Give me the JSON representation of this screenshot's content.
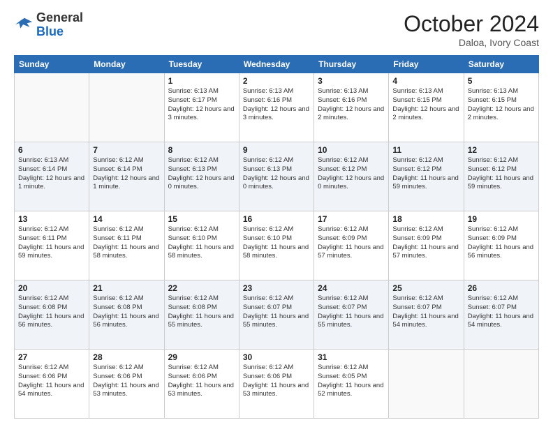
{
  "header": {
    "logo_line1": "General",
    "logo_line2": "Blue",
    "month": "October 2024",
    "location": "Daloa, Ivory Coast"
  },
  "days_of_week": [
    "Sunday",
    "Monday",
    "Tuesday",
    "Wednesday",
    "Thursday",
    "Friday",
    "Saturday"
  ],
  "weeks": [
    [
      {
        "day": "",
        "info": ""
      },
      {
        "day": "",
        "info": ""
      },
      {
        "day": "1",
        "info": "Sunrise: 6:13 AM\nSunset: 6:17 PM\nDaylight: 12 hours and 3 minutes."
      },
      {
        "day": "2",
        "info": "Sunrise: 6:13 AM\nSunset: 6:16 PM\nDaylight: 12 hours and 3 minutes."
      },
      {
        "day": "3",
        "info": "Sunrise: 6:13 AM\nSunset: 6:16 PM\nDaylight: 12 hours and 2 minutes."
      },
      {
        "day": "4",
        "info": "Sunrise: 6:13 AM\nSunset: 6:15 PM\nDaylight: 12 hours and 2 minutes."
      },
      {
        "day": "5",
        "info": "Sunrise: 6:13 AM\nSunset: 6:15 PM\nDaylight: 12 hours and 2 minutes."
      }
    ],
    [
      {
        "day": "6",
        "info": "Sunrise: 6:13 AM\nSunset: 6:14 PM\nDaylight: 12 hours and 1 minute."
      },
      {
        "day": "7",
        "info": "Sunrise: 6:12 AM\nSunset: 6:14 PM\nDaylight: 12 hours and 1 minute."
      },
      {
        "day": "8",
        "info": "Sunrise: 6:12 AM\nSunset: 6:13 PM\nDaylight: 12 hours and 0 minutes."
      },
      {
        "day": "9",
        "info": "Sunrise: 6:12 AM\nSunset: 6:13 PM\nDaylight: 12 hours and 0 minutes."
      },
      {
        "day": "10",
        "info": "Sunrise: 6:12 AM\nSunset: 6:12 PM\nDaylight: 12 hours and 0 minutes."
      },
      {
        "day": "11",
        "info": "Sunrise: 6:12 AM\nSunset: 6:12 PM\nDaylight: 11 hours and 59 minutes."
      },
      {
        "day": "12",
        "info": "Sunrise: 6:12 AM\nSunset: 6:12 PM\nDaylight: 11 hours and 59 minutes."
      }
    ],
    [
      {
        "day": "13",
        "info": "Sunrise: 6:12 AM\nSunset: 6:11 PM\nDaylight: 11 hours and 59 minutes."
      },
      {
        "day": "14",
        "info": "Sunrise: 6:12 AM\nSunset: 6:11 PM\nDaylight: 11 hours and 58 minutes."
      },
      {
        "day": "15",
        "info": "Sunrise: 6:12 AM\nSunset: 6:10 PM\nDaylight: 11 hours and 58 minutes."
      },
      {
        "day": "16",
        "info": "Sunrise: 6:12 AM\nSunset: 6:10 PM\nDaylight: 11 hours and 58 minutes."
      },
      {
        "day": "17",
        "info": "Sunrise: 6:12 AM\nSunset: 6:09 PM\nDaylight: 11 hours and 57 minutes."
      },
      {
        "day": "18",
        "info": "Sunrise: 6:12 AM\nSunset: 6:09 PM\nDaylight: 11 hours and 57 minutes."
      },
      {
        "day": "19",
        "info": "Sunrise: 6:12 AM\nSunset: 6:09 PM\nDaylight: 11 hours and 56 minutes."
      }
    ],
    [
      {
        "day": "20",
        "info": "Sunrise: 6:12 AM\nSunset: 6:08 PM\nDaylight: 11 hours and 56 minutes."
      },
      {
        "day": "21",
        "info": "Sunrise: 6:12 AM\nSunset: 6:08 PM\nDaylight: 11 hours and 56 minutes."
      },
      {
        "day": "22",
        "info": "Sunrise: 6:12 AM\nSunset: 6:08 PM\nDaylight: 11 hours and 55 minutes."
      },
      {
        "day": "23",
        "info": "Sunrise: 6:12 AM\nSunset: 6:07 PM\nDaylight: 11 hours and 55 minutes."
      },
      {
        "day": "24",
        "info": "Sunrise: 6:12 AM\nSunset: 6:07 PM\nDaylight: 11 hours and 55 minutes."
      },
      {
        "day": "25",
        "info": "Sunrise: 6:12 AM\nSunset: 6:07 PM\nDaylight: 11 hours and 54 minutes."
      },
      {
        "day": "26",
        "info": "Sunrise: 6:12 AM\nSunset: 6:07 PM\nDaylight: 11 hours and 54 minutes."
      }
    ],
    [
      {
        "day": "27",
        "info": "Sunrise: 6:12 AM\nSunset: 6:06 PM\nDaylight: 11 hours and 54 minutes."
      },
      {
        "day": "28",
        "info": "Sunrise: 6:12 AM\nSunset: 6:06 PM\nDaylight: 11 hours and 53 minutes."
      },
      {
        "day": "29",
        "info": "Sunrise: 6:12 AM\nSunset: 6:06 PM\nDaylight: 11 hours and 53 minutes."
      },
      {
        "day": "30",
        "info": "Sunrise: 6:12 AM\nSunset: 6:06 PM\nDaylight: 11 hours and 53 minutes."
      },
      {
        "day": "31",
        "info": "Sunrise: 6:12 AM\nSunset: 6:05 PM\nDaylight: 11 hours and 52 minutes."
      },
      {
        "day": "",
        "info": ""
      },
      {
        "day": "",
        "info": ""
      }
    ]
  ]
}
